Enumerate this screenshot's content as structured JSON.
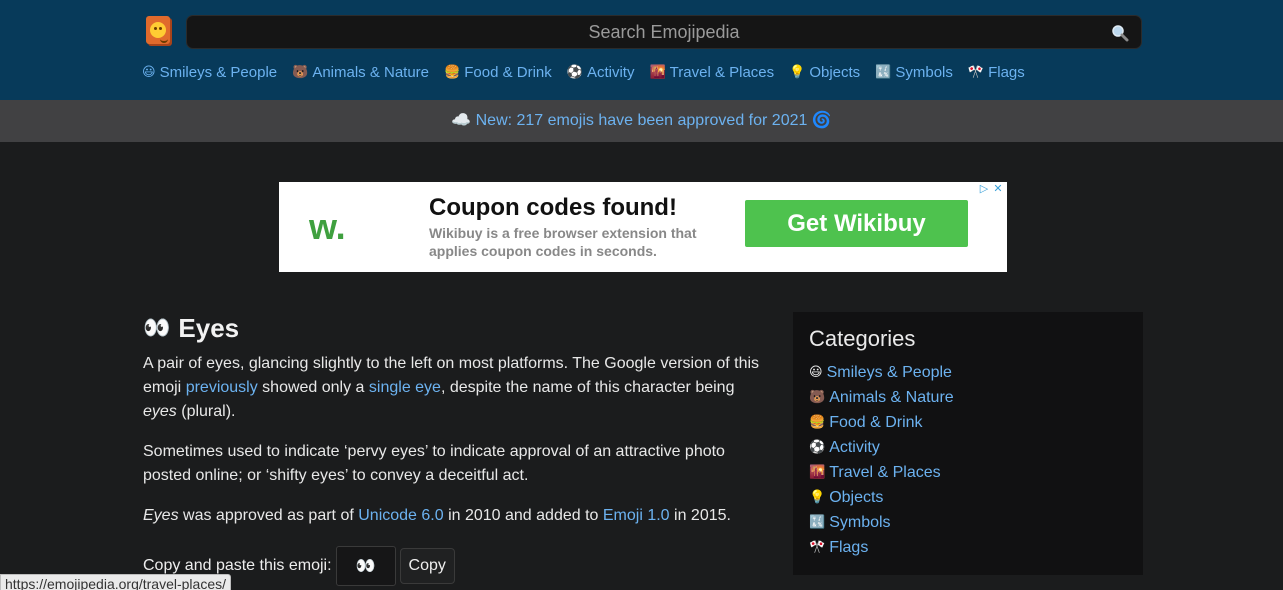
{
  "header": {
    "search_placeholder": "Search Emojipedia",
    "nav": [
      {
        "icon": "😃",
        "label": "Smileys & People"
      },
      {
        "icon": "🐻",
        "label": "Animals & Nature"
      },
      {
        "icon": "🍔",
        "label": "Food & Drink"
      },
      {
        "icon": "⚽",
        "label": "Activity"
      },
      {
        "icon": "🌇",
        "label": "Travel & Places"
      },
      {
        "icon": "💡",
        "label": "Objects"
      },
      {
        "icon": "🔣",
        "label": "Symbols"
      },
      {
        "icon": "🎌",
        "label": "Flags"
      }
    ]
  },
  "banner": {
    "icon_left": "☁️",
    "text": "New: 217 emojis have been approved for 2021",
    "icon_right": "🌀"
  },
  "ad": {
    "logo": "w.",
    "title": "Coupon codes found!",
    "subtitle": "Wikibuy is a free browser extension that applies coupon codes in seconds.",
    "button": "Get Wikibuy",
    "choices_play": "▷",
    "choices_close": "✕"
  },
  "emoji": {
    "char": "👀",
    "title": "Eyes",
    "p1_a": "A pair of eyes, glancing slightly to the left on most platforms. The Google version of this emoji ",
    "p1_link1": "previously",
    "p1_b": " showed only a ",
    "p1_link2": "single eye",
    "p1_c": ", despite the name of this character being ",
    "p1_em": "eyes",
    "p1_d": " (plural).",
    "p2": "Sometimes used to indicate ‘pervy eyes’ to indicate approval of an attractive photo posted online; or ‘shifty eyes’ to convey a deceitful act.",
    "p3_em": "Eyes",
    "p3_a": " was approved as part of ",
    "p3_link1": "Unicode 6.0",
    "p3_b": " in 2010 and added to ",
    "p3_link2": "Emoji 1.0",
    "p3_c": " in 2015.",
    "copy_label": "Copy and paste this emoji:",
    "copy_value": "👀",
    "copy_button": "Copy"
  },
  "sidebar": {
    "title": "Categories",
    "items": [
      {
        "icon": "😃",
        "label": "Smileys & People"
      },
      {
        "icon": "🐻",
        "label": "Animals & Nature"
      },
      {
        "icon": "🍔",
        "label": "Food & Drink"
      },
      {
        "icon": "⚽",
        "label": "Activity"
      },
      {
        "icon": "🌇",
        "label": "Travel & Places"
      },
      {
        "icon": "💡",
        "label": "Objects"
      },
      {
        "icon": "🔣",
        "label": "Symbols"
      },
      {
        "icon": "🎌",
        "label": "Flags"
      }
    ]
  },
  "status_url": "https://emojipedia.org/travel-places/",
  "colors": {
    "header_bg": "#073a5a",
    "banner_bg": "#414143",
    "page_bg": "#1b1c1d",
    "link": "#6cb2f0",
    "ad_button": "#4ec24e"
  }
}
